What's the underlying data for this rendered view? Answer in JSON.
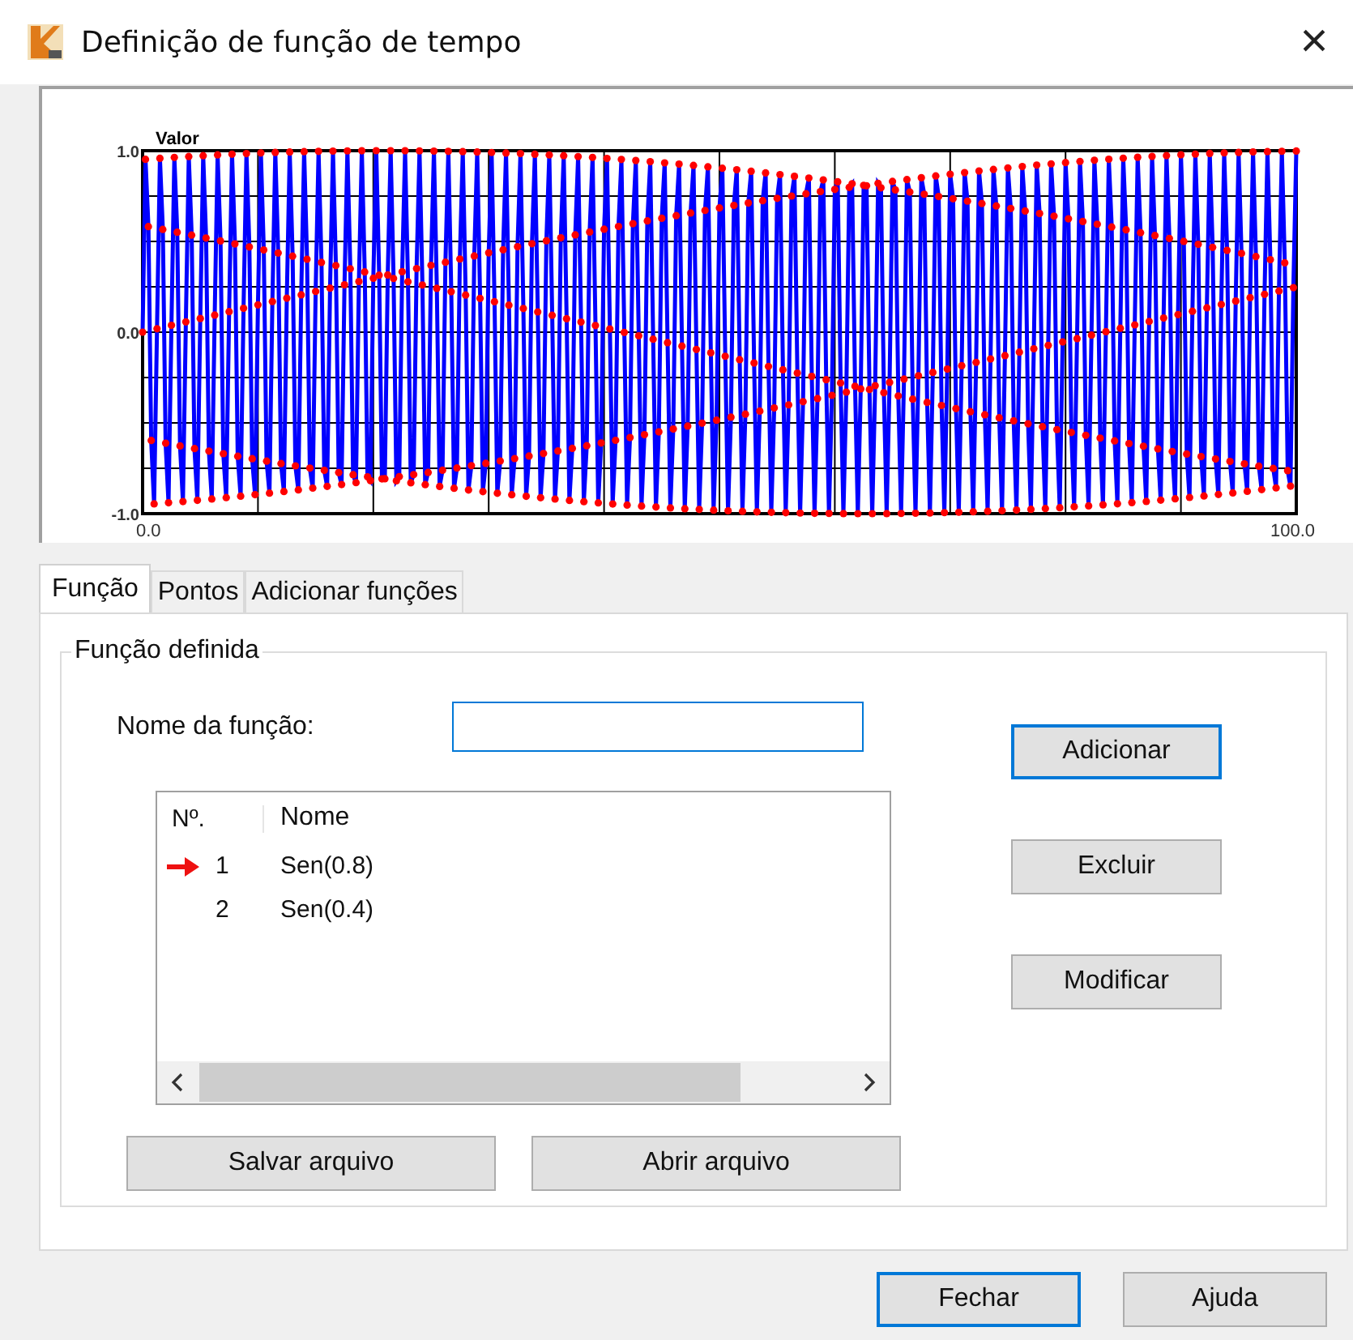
{
  "window": {
    "title": "Definição de função de tempo",
    "close": "×"
  },
  "chart": {
    "ylabel": "Valor",
    "yticks": [
      "1.0",
      "0.0",
      "-1.0"
    ],
    "xticks": [
      "0.0",
      "100.0"
    ]
  },
  "tabs": [
    {
      "label": "Função",
      "selected": true
    },
    {
      "label": "Pontos",
      "selected": false
    },
    {
      "label": "Adicionar funções",
      "selected": false
    }
  ],
  "group": {
    "title": "Função definida"
  },
  "name_field": {
    "label": "Nome da função:"
  },
  "list": {
    "columns": [
      "Nº.",
      "Nome"
    ],
    "rows": [
      {
        "no": "1",
        "name": "Sen(0.8)",
        "current": true
      },
      {
        "no": "2",
        "name": "Sen(0.4)",
        "current": false
      }
    ]
  },
  "side_buttons": [
    {
      "label": "Adicionar",
      "default": true
    },
    {
      "label": "Excluir",
      "default": false
    },
    {
      "label": "Modificar",
      "default": false
    }
  ],
  "file_buttons": [
    "Salvar arquivo",
    "Abrir arquivo"
  ],
  "footer_buttons": [
    {
      "label": "Fechar",
      "default": true
    },
    {
      "label": "Ajuda",
      "default": false
    }
  ]
}
